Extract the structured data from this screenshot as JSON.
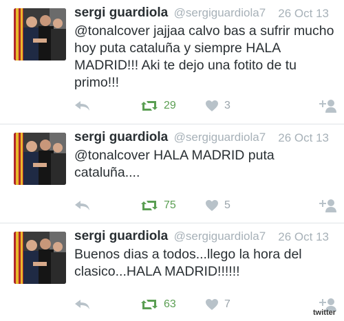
{
  "tweets": [
    {
      "name": "sergi guardiola",
      "handle": "@sergiguardiola7",
      "date": "26 Oct 13",
      "text": "@tonalcover jajjaa calvo bas a sufrir mucho hoy puta cataluña y siempre HALA MADRID!!! Aki te dejo una fotito de tu primo!!!",
      "retweets": "29",
      "favorites": "3"
    },
    {
      "name": "sergi guardiola",
      "handle": "@sergiguardiola7",
      "date": "26 Oct 13",
      "text": "@tonalcover HALA MADRID puta cataluña....",
      "retweets": "75",
      "favorites": "5"
    },
    {
      "name": "sergi guardiola",
      "handle": "@sergiguardiola7",
      "date": "26 Oct 13",
      "text": "Buenos dias a todos...llego la hora del clasico...HALA MADRID!!!!!!",
      "retweets": "63",
      "favorites": "7"
    }
  ],
  "icons": {
    "reply": "reply-icon",
    "retweet": "retweet-icon",
    "favorite": "heart-icon",
    "follow": "follow-user-icon"
  },
  "colors": {
    "retweet_green": "#5a9e52",
    "muted_gray": "#a7b1b8",
    "icon_gray": "#b8c2c9"
  },
  "watermark": "twitter"
}
